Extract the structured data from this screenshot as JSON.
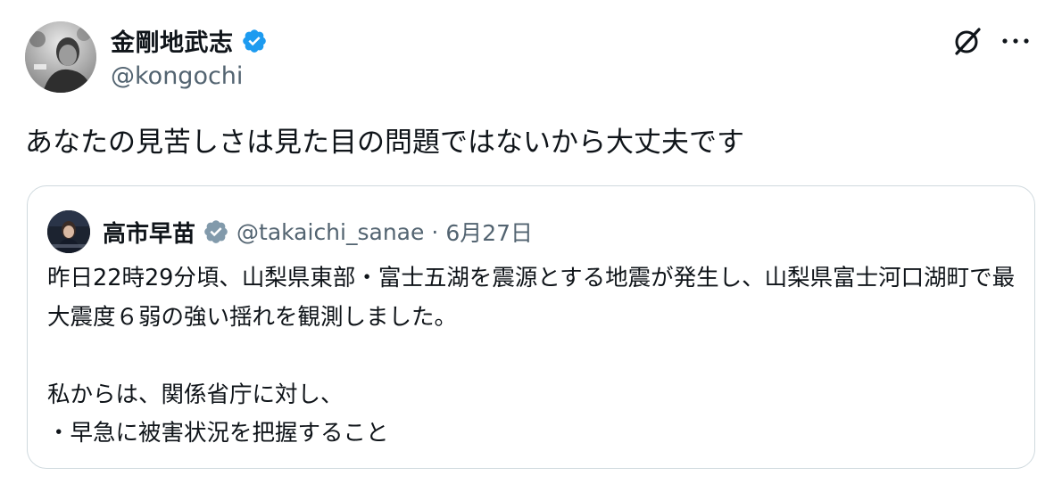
{
  "author": {
    "display_name": "金剛地武志",
    "handle": "@kongochi",
    "avatar": "avatar-photo"
  },
  "tweet": {
    "text": "あなたの見苦しさは見た目の問題ではないから大丈夫です"
  },
  "actions": {
    "grok_icon": "grok-icon",
    "more_icon": "more-options-icon"
  },
  "quoted": {
    "display_name": "高市早苗",
    "handle": "@takaichi_sanae",
    "separator": "·",
    "date": "6月27日",
    "text": "昨日22時29分頃、山梨県東部・富士五湖を震源とする地震が発生し、山梨県富士河口湖町で最大震度６弱の強い揺れを観測しました。\n\n私からは、関係省庁に対し、\n・早急に被害状況を把握すること"
  },
  "colors": {
    "verified_blue": "#1d9bf0",
    "verified_gray": "#829aab",
    "text_primary": "#0f1419",
    "text_secondary": "#536471",
    "border": "#cfd9de"
  }
}
